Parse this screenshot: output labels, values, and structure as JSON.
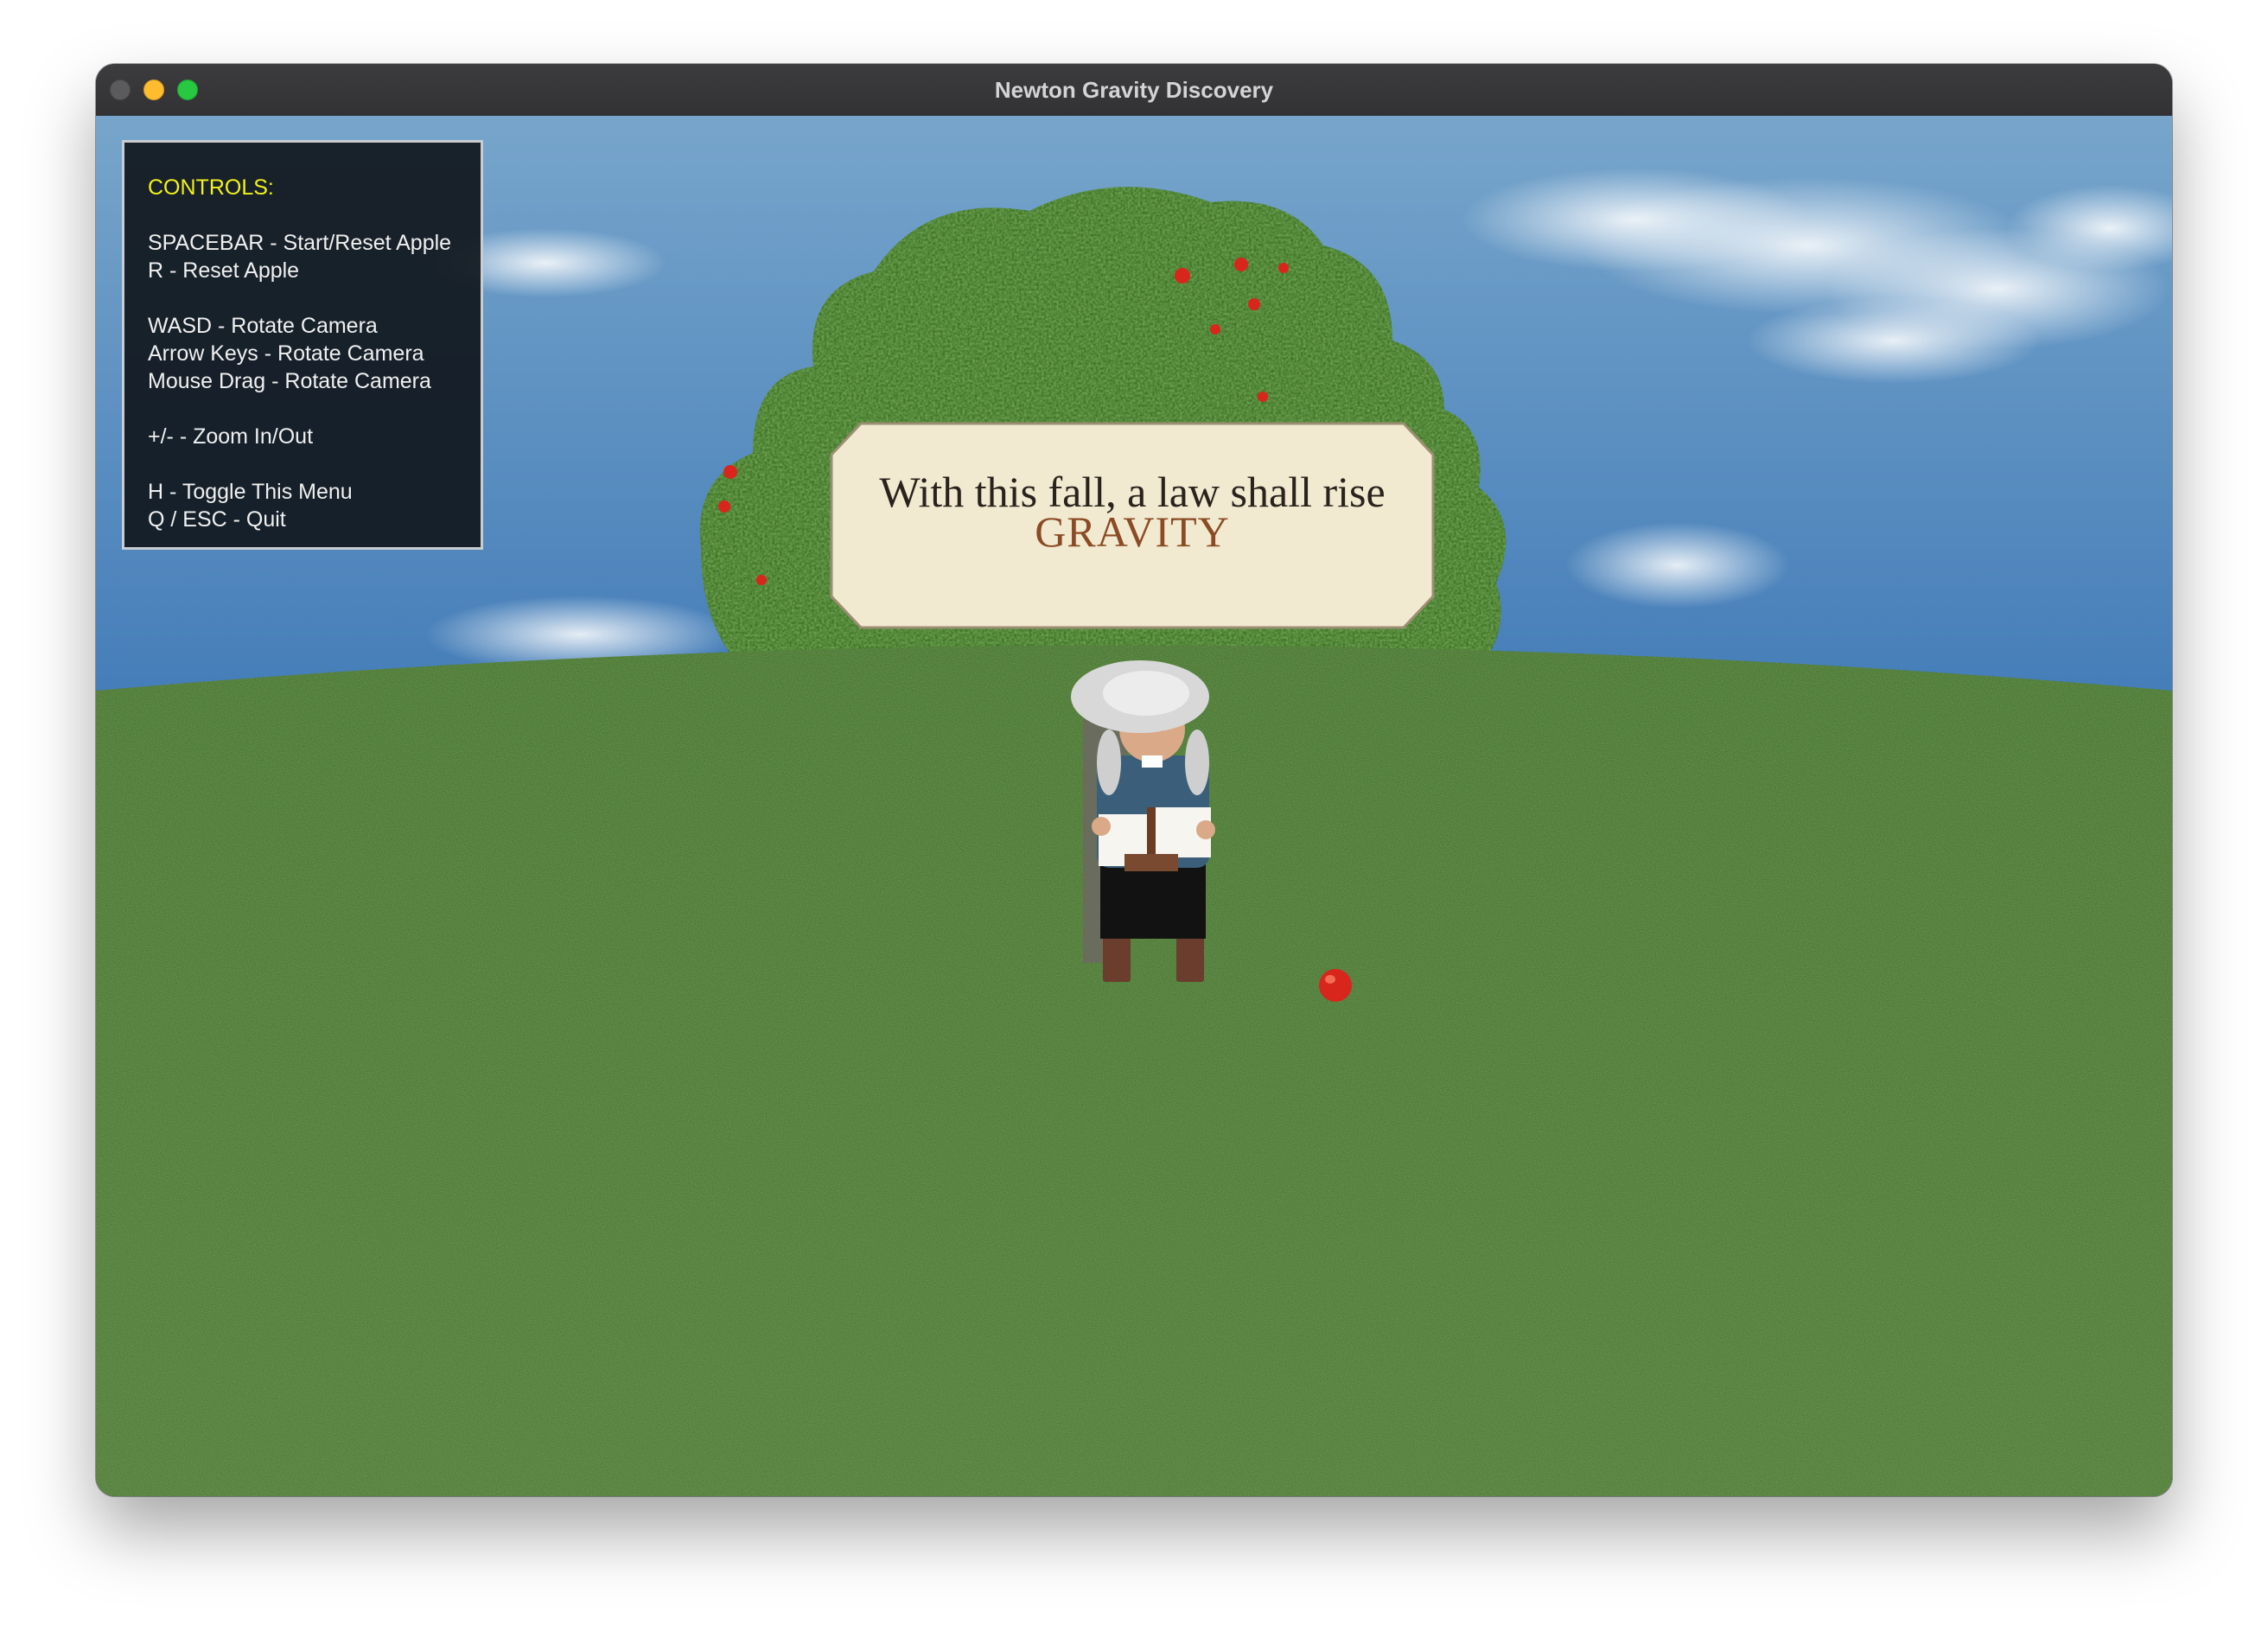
{
  "window": {
    "title": "Newton Gravity Discovery"
  },
  "controls_panel": {
    "heading": "CONTROLS:",
    "groups": [
      [
        "SPACEBAR - Start/Reset Apple",
        "R - Reset Apple"
      ],
      [
        "WASD - Rotate Camera",
        "Arrow Keys - Rotate Camera",
        "Mouse Drag - Rotate Camera"
      ],
      [
        "+/- - Zoom In/Out"
      ],
      [
        "H - Toggle This Menu",
        "Q / ESC - Quit"
      ]
    ]
  },
  "banner": {
    "line1": "With this fall, a law shall rise",
    "line2": "GRAVITY"
  },
  "colors": {
    "sky_top": "#6f9fc7",
    "sky_bottom": "#3f79b6",
    "grass": "#3d6a24",
    "foliage": "#2f6b1a",
    "apple": "#d8261c",
    "banner_fill": "#f1e9d0",
    "banner_border": "#9c8e72",
    "heading_yellow": "#f2f21a",
    "gravity_text": "#8b4b24"
  }
}
